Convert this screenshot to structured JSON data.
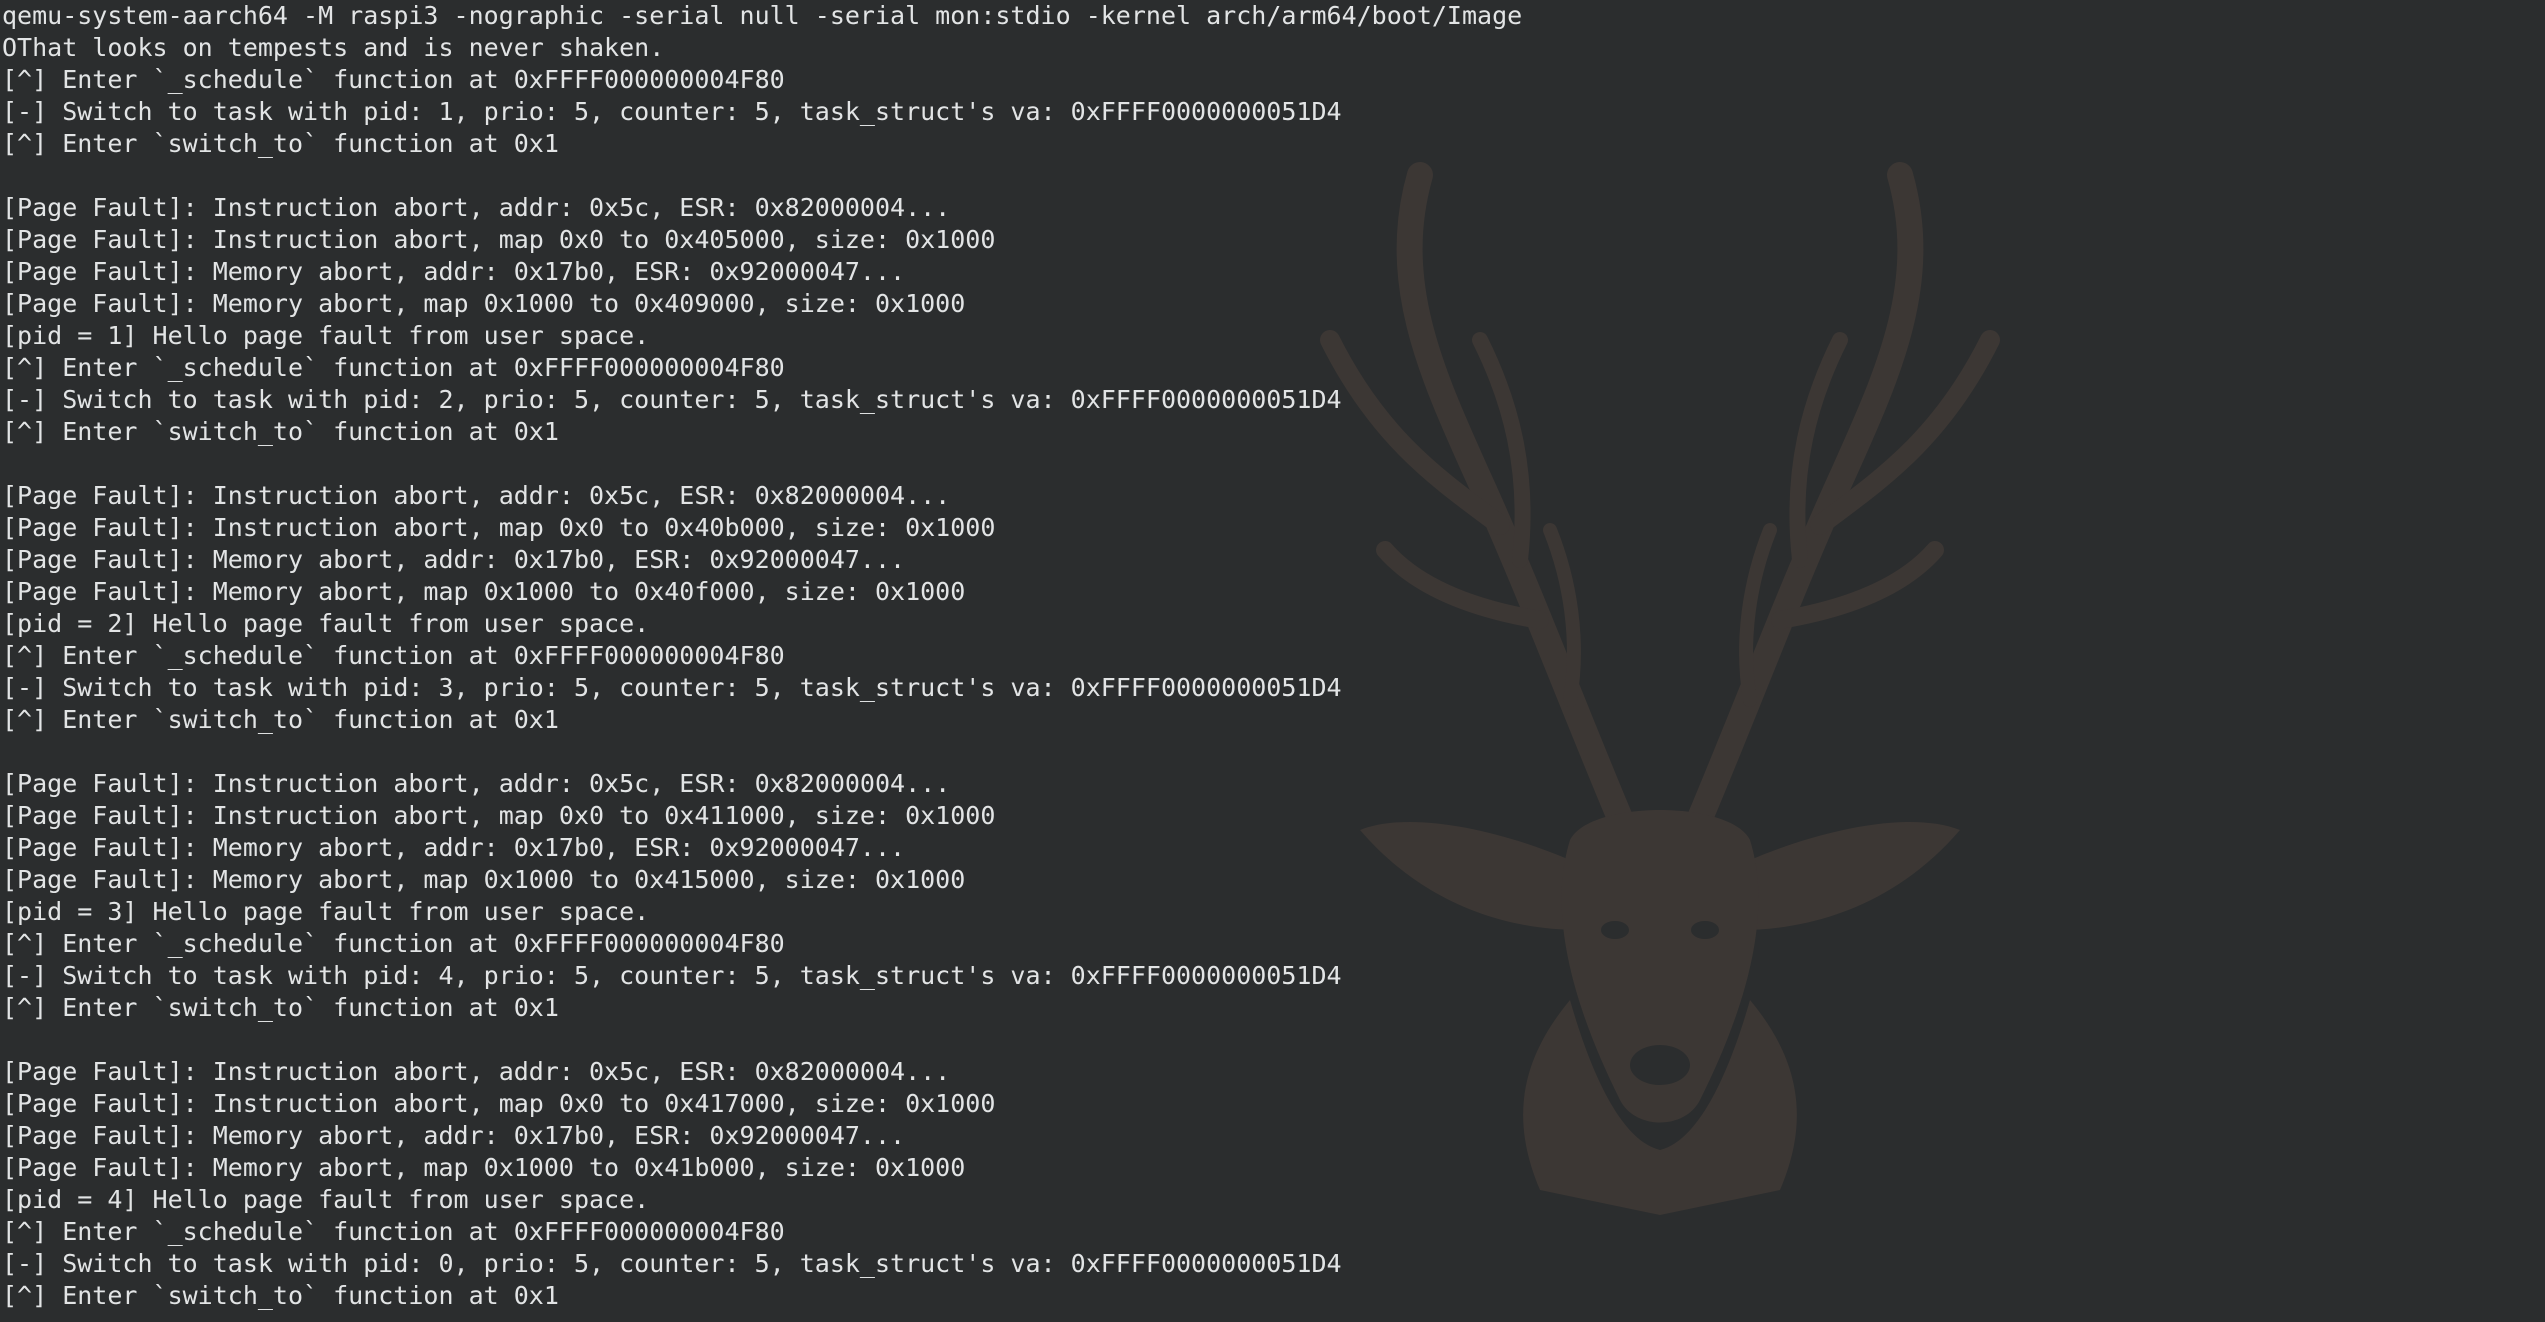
{
  "terminal": {
    "background_color": "#2b2d2e",
    "text_color": "#e2e4e5",
    "wallpaper": "deer-head-silhouette",
    "wallpaper_color": "#3c3734",
    "lines": [
      "qemu-system-aarch64 -M raspi3 -nographic -serial null -serial mon:stdio -kernel arch/arm64/boot/Image",
      "OThat looks on tempests and is never shaken.",
      "[^] Enter `_schedule` function at 0xFFFF000000004F80",
      "[-] Switch to task with pid: 1, prio: 5, counter: 5, task_struct's va: 0xFFFF0000000051D4",
      "[^] Enter `switch_to` function at 0x1",
      "",
      "[Page Fault]: Instruction abort, addr: 0x5c, ESR: 0x82000004...",
      "[Page Fault]: Instruction abort, map 0x0 to 0x405000, size: 0x1000",
      "[Page Fault]: Memory abort, addr: 0x17b0, ESR: 0x92000047...",
      "[Page Fault]: Memory abort, map 0x1000 to 0x409000, size: 0x1000",
      "[pid = 1] Hello page fault from user space.",
      "[^] Enter `_schedule` function at 0xFFFF000000004F80",
      "[-] Switch to task with pid: 2, prio: 5, counter: 5, task_struct's va: 0xFFFF0000000051D4",
      "[^] Enter `switch_to` function at 0x1",
      "",
      "[Page Fault]: Instruction abort, addr: 0x5c, ESR: 0x82000004...",
      "[Page Fault]: Instruction abort, map 0x0 to 0x40b000, size: 0x1000",
      "[Page Fault]: Memory abort, addr: 0x17b0, ESR: 0x92000047...",
      "[Page Fault]: Memory abort, map 0x1000 to 0x40f000, size: 0x1000",
      "[pid = 2] Hello page fault from user space.",
      "[^] Enter `_schedule` function at 0xFFFF000000004F80",
      "[-] Switch to task with pid: 3, prio: 5, counter: 5, task_struct's va: 0xFFFF0000000051D4",
      "[^] Enter `switch_to` function at 0x1",
      "",
      "[Page Fault]: Instruction abort, addr: 0x5c, ESR: 0x82000004...",
      "[Page Fault]: Instruction abort, map 0x0 to 0x411000, size: 0x1000",
      "[Page Fault]: Memory abort, addr: 0x17b0, ESR: 0x92000047...",
      "[Page Fault]: Memory abort, map 0x1000 to 0x415000, size: 0x1000",
      "[pid = 3] Hello page fault from user space.",
      "[^] Enter `_schedule` function at 0xFFFF000000004F80",
      "[-] Switch to task with pid: 4, prio: 5, counter: 5, task_struct's va: 0xFFFF0000000051D4",
      "[^] Enter `switch_to` function at 0x1",
      "",
      "[Page Fault]: Instruction abort, addr: 0x5c, ESR: 0x82000004...",
      "[Page Fault]: Instruction abort, map 0x0 to 0x417000, size: 0x1000",
      "[Page Fault]: Memory abort, addr: 0x17b0, ESR: 0x92000047...",
      "[Page Fault]: Memory abort, map 0x1000 to 0x41b000, size: 0x1000",
      "[pid = 4] Hello page fault from user space.",
      "[^] Enter `_schedule` function at 0xFFFF000000004F80",
      "[-] Switch to task with pid: 0, prio: 5, counter: 5, task_struct's va: 0xFFFF0000000051D4",
      "[^] Enter `switch_to` function at 0x1"
    ]
  }
}
